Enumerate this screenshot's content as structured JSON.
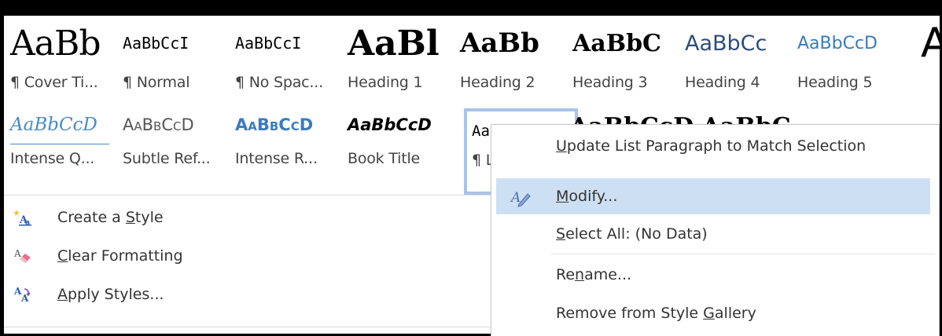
{
  "gallery": {
    "row1": [
      {
        "preview": "AaBb",
        "name": "¶ Cover Ti..."
      },
      {
        "preview": "AaBbCcI",
        "name": "¶ Normal"
      },
      {
        "preview": "AaBbCcI",
        "name": "¶ No Spac..."
      },
      {
        "preview": "AaBl",
        "name": "Heading 1"
      },
      {
        "preview": "AaBb",
        "name": "Heading 2"
      },
      {
        "preview": "AaBbC",
        "name": "Heading 3"
      },
      {
        "preview": "AaBbCc",
        "name": "Heading 4"
      },
      {
        "preview": "AaBbCcD",
        "name": "Heading 5"
      },
      {
        "preview": "A",
        "name": ""
      }
    ],
    "row2": [
      {
        "preview": "AaBbCcD",
        "name": "Intense Q..."
      },
      {
        "preview": "AaBbCcD",
        "name": "Subtle Ref..."
      },
      {
        "preview": "AaBbCcD",
        "name": "Intense R..."
      },
      {
        "preview": "AaBbCcD",
        "name": "Book Title"
      },
      {
        "preview": "AaBbCcI",
        "name": "¶ Lis"
      }
    ],
    "row2_overflow_preview": "AaBbCcD  AaBbC"
  },
  "commands": {
    "create_style": {
      "pre": "Create a ",
      "mnemonic": "S",
      "post": "tyle"
    },
    "clear_formatting": {
      "pre": "",
      "mnemonic": "C",
      "post": "lear Formatting"
    },
    "apply_styles": {
      "pre": "",
      "mnemonic": "A",
      "post": "pply Styles..."
    }
  },
  "context_menu": {
    "update": {
      "pre": "",
      "mnemonic": "U",
      "post": "pdate List Paragraph to Match Selection"
    },
    "modify": {
      "pre": "",
      "mnemonic": "M",
      "post": "odify..."
    },
    "select_all": {
      "pre": "",
      "mnemonic": "S",
      "post": "elect All: (No Data)"
    },
    "rename": {
      "pre": "Re",
      "mnemonic": "n",
      "post": "ame..."
    },
    "remove": {
      "pre": "Remove from Style ",
      "mnemonic": "G",
      "post": "allery"
    }
  },
  "colors": {
    "selection_border": "#a9c4e6",
    "menu_highlight": "#cde0f3",
    "heading_blue": "#3a7bbd"
  }
}
